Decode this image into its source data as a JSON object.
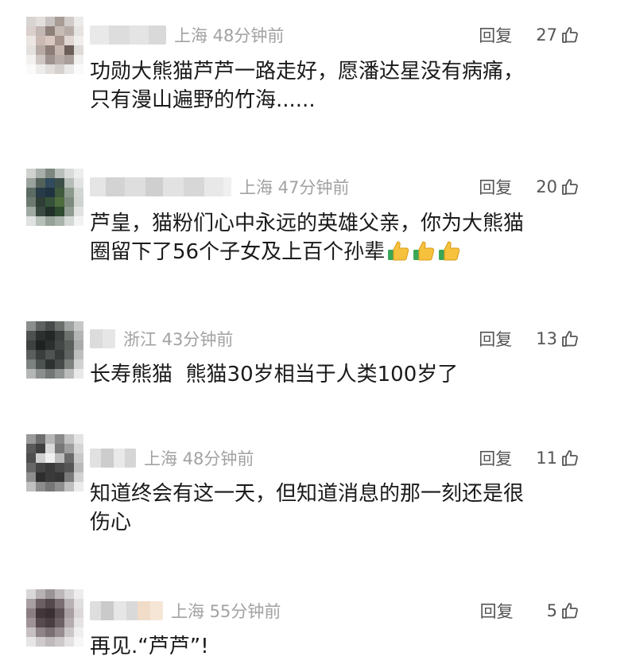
{
  "comments": [
    {
      "location_time": "上海 48分钟前",
      "reply_label": "回复",
      "likes": "27",
      "text": "功勋大熊猫芦芦一路走好，愿潘达星没有病痛，\n只有漫山遍野的竹海......",
      "emoji_count": 0
    },
    {
      "location_time": "上海 47分钟前",
      "reply_label": "回复",
      "likes": "20",
      "text": "芦皇，猫粉们心中永远的英雄父亲，你为大熊猫\n圈留下了56个子女及上百个孙辈",
      "emoji": "thumbs-up-icon",
      "emoji_count": 3
    },
    {
      "location_time": "浙江 43分钟前",
      "reply_label": "回复",
      "likes": "13",
      "text": "长寿熊猫  熊猫30岁相当于人类100岁了",
      "emoji_count": 0
    },
    {
      "location_time": "上海 48分钟前",
      "reply_label": "回复",
      "likes": "11",
      "text": "知道终会有这一天，但知道消息的那一刻还是很\n伤心",
      "emoji_count": 0
    },
    {
      "location_time": "上海 55分钟前",
      "reply_label": "回复",
      "likes": "5",
      "text": "再见.“芦芦”!",
      "emoji_count": 0
    }
  ],
  "icons": {
    "like": "thumbs-up-outline-icon",
    "emoji": "thumbs-up-emoji-icon"
  },
  "colors": {
    "meta_text": "#a2a2a2",
    "action_text": "#555555",
    "body_text": "#1a1a1a"
  }
}
